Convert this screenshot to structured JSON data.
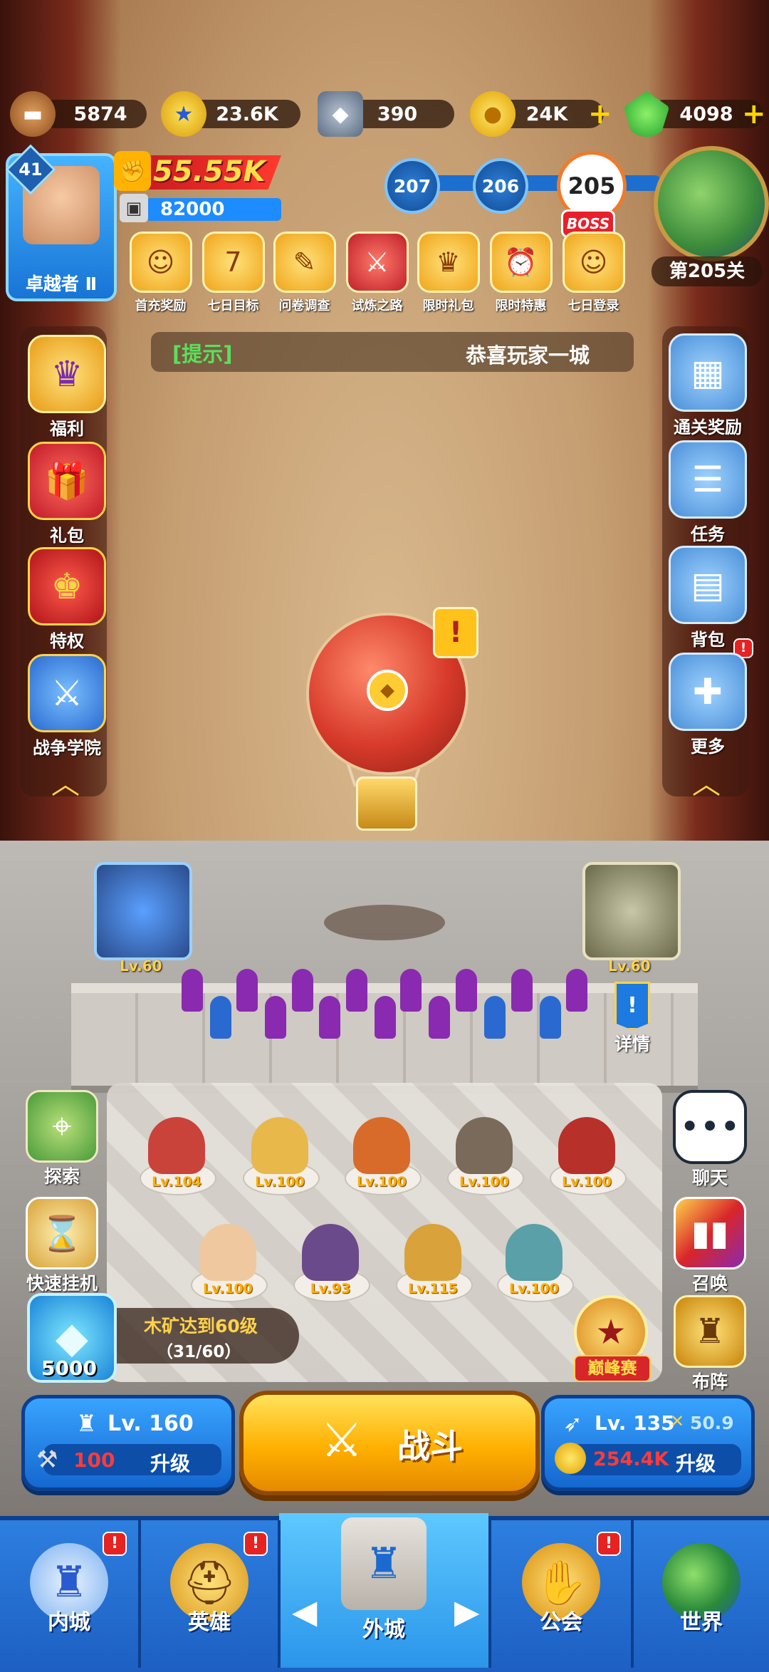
{
  "resources": {
    "wood": {
      "value": "5874",
      "icon": "wood-log-icon"
    },
    "stars": {
      "value": "23.6K",
      "icon": "star-coin-icon"
    },
    "stone": {
      "value": "390",
      "icon": "stone-ore-icon"
    },
    "gold": {
      "value": "24K",
      "icon": "gold-coin-icon",
      "plus": "+"
    },
    "gems": {
      "value": "4098",
      "icon": "green-gem-icon",
      "plus": "+"
    }
  },
  "player": {
    "level": "41",
    "name": "卓越者 Ⅱ",
    "power": "55.55K",
    "sub_value": "82000"
  },
  "stages": {
    "prev2": "207",
    "prev1": "206",
    "current": "205",
    "boss_label": "BOSS",
    "map_label": "第205关"
  },
  "events": [
    {
      "label": "首充奖励",
      "icon": "first-recharge-girl-icon"
    },
    {
      "label": "七日目标",
      "icon": "seven-day-shield-icon"
    },
    {
      "label": "问卷调查",
      "icon": "survey-scroll-icon"
    },
    {
      "label": "试炼之路",
      "icon": "trial-road-icon"
    },
    {
      "label": "限时礼包",
      "icon": "limited-gift-icon"
    },
    {
      "label": "限时特惠",
      "icon": "limited-offer-icon"
    },
    {
      "label": "七日登录",
      "icon": "seven-day-login-girl-icon"
    }
  ],
  "tip": {
    "label": "[提示]",
    "message": "恭喜玩家一城"
  },
  "left_menu": [
    {
      "label": "福利",
      "icon": "crown-badge-icon"
    },
    {
      "label": "礼包",
      "icon": "gift-box-icon"
    },
    {
      "label": "特权",
      "icon": "crown-shield-icon"
    },
    {
      "label": "战争学院",
      "icon": "crossed-swords-shield-icon"
    }
  ],
  "right_menu": [
    {
      "label": "通关奖励",
      "icon": "reward-chest-icon"
    },
    {
      "label": "任务",
      "icon": "task-clipboard-icon"
    },
    {
      "label": "背包",
      "icon": "backpack-icon"
    },
    {
      "label": "更多",
      "icon": "plus-dpad-icon"
    }
  ],
  "towers": {
    "left_level": "Lv.60",
    "right_level": "Lv.60",
    "details_label": "详情"
  },
  "heroes": [
    {
      "level": "Lv.104",
      "color": "#c9433a"
    },
    {
      "level": "Lv.100",
      "color": "#e8b84a"
    },
    {
      "level": "Lv.100",
      "color": "#d86a2a"
    },
    {
      "level": "Lv.100",
      "color": "#7a6a5a"
    },
    {
      "level": "Lv.100",
      "color": "#b8302a"
    },
    {
      "level": "Lv.100",
      "color": "#f0c8a0"
    },
    {
      "level": "Lv.93",
      "color": "#6a4a8a"
    },
    {
      "level": "Lv.115",
      "color": "#d9a23a"
    },
    {
      "level": "Lv.100",
      "color": "#5aa0a8"
    }
  ],
  "lower_left": [
    {
      "label": "探索",
      "icon": "explore-map-icon"
    },
    {
      "label": "快速挂机",
      "icon": "hourglass-icon"
    }
  ],
  "lower_right": [
    {
      "label": "聊天",
      "icon": "chat-bubble-icon"
    },
    {
      "label": "召唤",
      "icon": "summon-cards-icon"
    },
    {
      "label": "布阵",
      "icon": "formation-tower-icon"
    }
  ],
  "quest": {
    "title": "木矿达到60级",
    "progress": "（31/60）",
    "crystal_count": "5000"
  },
  "peak_label": "巅峰赛",
  "castle_upgrade": {
    "level": "Lv. 160",
    "cost": "100",
    "label": "升级"
  },
  "battle_label": "战斗",
  "archer_upgrade": {
    "level": "Lv. 135",
    "attack": "50.9",
    "cost": "254.4K",
    "label": "升级"
  },
  "nav": [
    {
      "label": "内城",
      "icon": "inner-castle-icon",
      "alert": "!"
    },
    {
      "label": "英雄",
      "icon": "hero-helmet-icon",
      "alert": "!"
    },
    {
      "label": "外城",
      "icon": "outer-castle-icon"
    },
    {
      "label": "公会",
      "icon": "guild-handshake-icon",
      "alert": "!"
    },
    {
      "label": "世界",
      "icon": "world-globe-icon"
    }
  ],
  "colors": {
    "accent_gold": "#ffd24a",
    "power_red": "#c0141d",
    "nav_blue": "#2d7fe0",
    "battle_yellow": "#ffb000",
    "cost_red": "#ff3b3b"
  }
}
